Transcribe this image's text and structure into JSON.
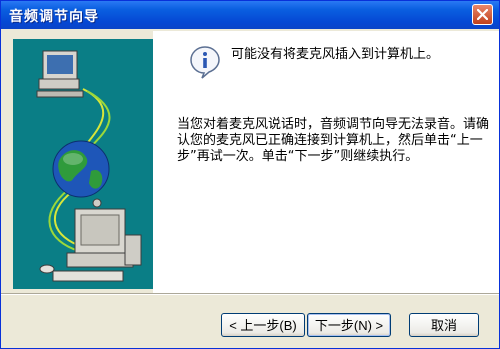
{
  "window": {
    "title": "音频调节向导",
    "accent_color": "#0548d4",
    "close_icon": "close-icon"
  },
  "content": {
    "heading": "可能没有将麦克风插入到计算机上。",
    "message": "当您对着麦克风说话时，音频调节向导无法录音。请确认您的麦克风已正确连接到计算机上，然后单击“上一步”再试一次。单击“下一步”则继续执行。",
    "icon": "info-icon"
  },
  "art": {
    "icon": "network-computers-illustration"
  },
  "buttons": {
    "back_label": "< 上一步(B)",
    "next_label": "下一步(N) >",
    "cancel_label": "取消"
  }
}
